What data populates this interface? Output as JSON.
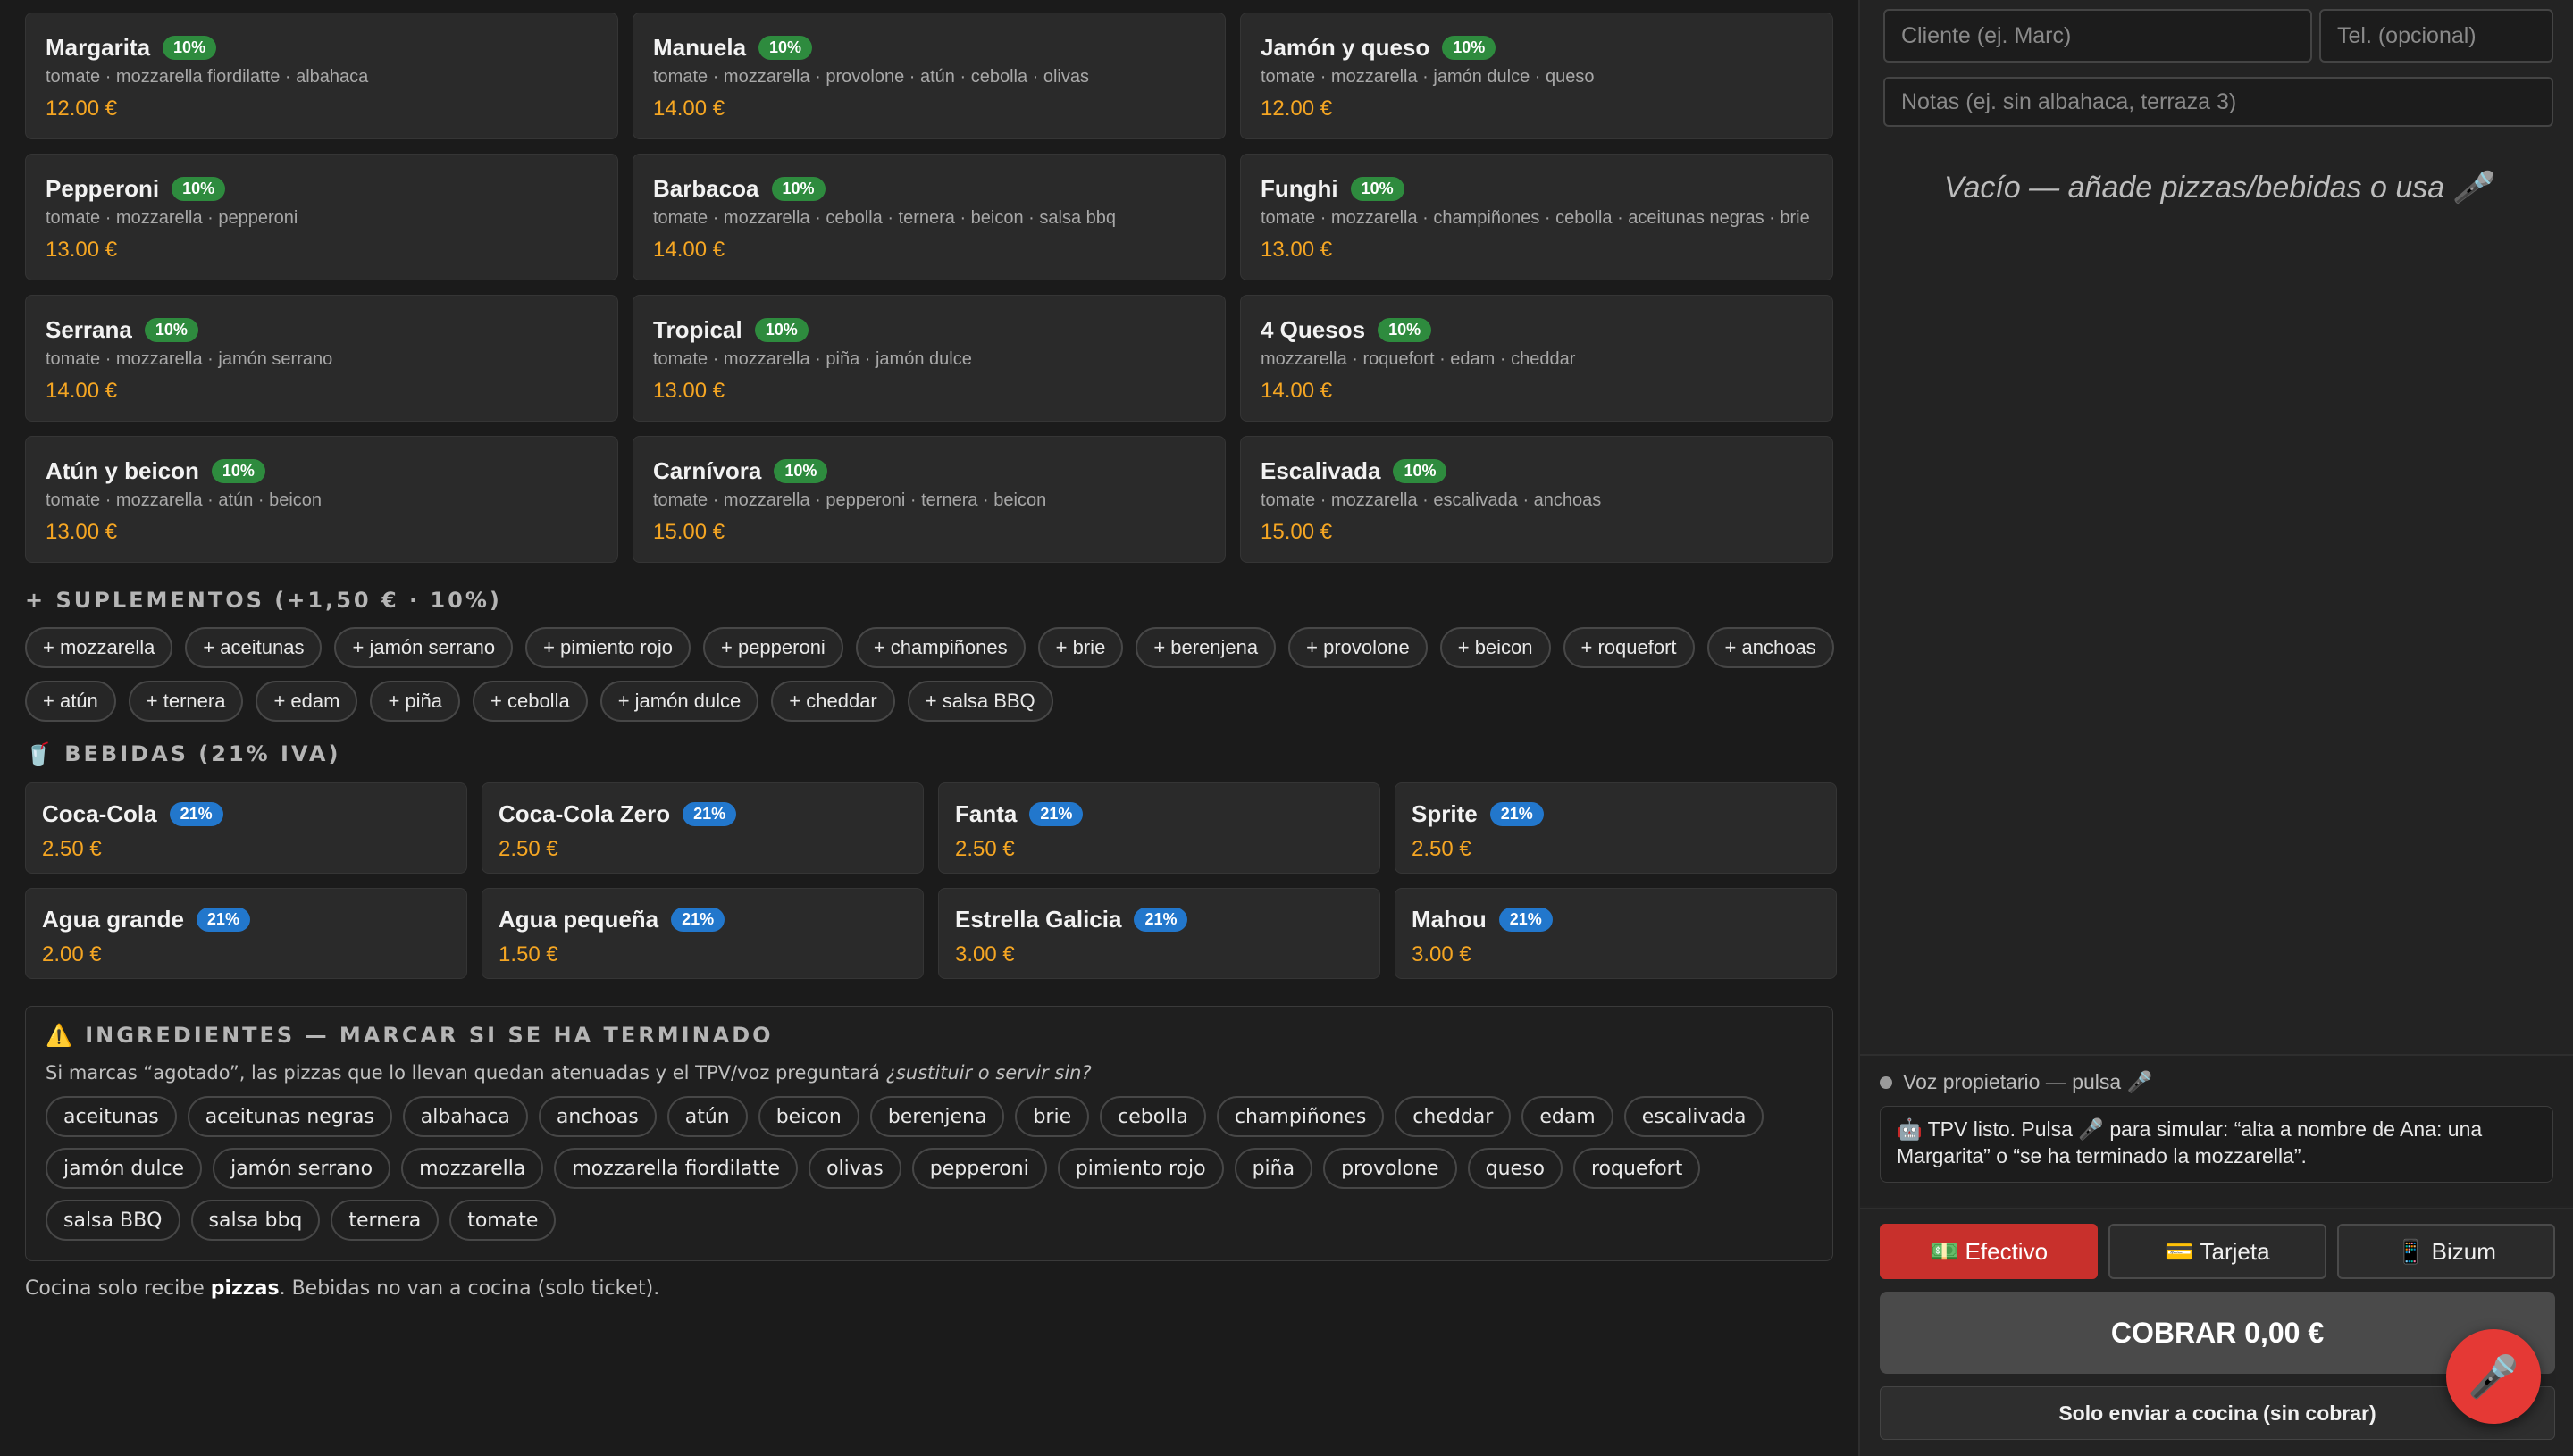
{
  "pizzas": [
    {
      "name": "Margarita",
      "badge": "10%",
      "ingredients": "tomate · mozzarella fiordilatte · albahaca",
      "price": "12.00 €"
    },
    {
      "name": "Manuela",
      "badge": "10%",
      "ingredients": "tomate · mozzarella · provolone · atún · cebolla · olivas",
      "price": "14.00 €"
    },
    {
      "name": "Jamón y queso",
      "badge": "10%",
      "ingredients": "tomate · mozzarella · jamón dulce · queso",
      "price": "12.00 €"
    },
    {
      "name": "Pepperoni",
      "badge": "10%",
      "ingredients": "tomate · mozzarella · pepperoni",
      "price": "13.00 €"
    },
    {
      "name": "Barbacoa",
      "badge": "10%",
      "ingredients": "tomate · mozzarella · cebolla · ternera · beicon · salsa bbq",
      "price": "14.00 €"
    },
    {
      "name": "Funghi",
      "badge": "10%",
      "ingredients": "tomate · mozzarella · champiñones · cebolla · aceitunas negras · brie",
      "price": "13.00 €"
    },
    {
      "name": "Serrana",
      "badge": "10%",
      "ingredients": "tomate · mozzarella · jamón serrano",
      "price": "14.00 €"
    },
    {
      "name": "Tropical",
      "badge": "10%",
      "ingredients": "tomate · mozzarella · piña · jamón dulce",
      "price": "13.00 €"
    },
    {
      "name": "4 Quesos",
      "badge": "10%",
      "ingredients": "mozzarella · roquefort · edam · cheddar",
      "price": "14.00 €"
    },
    {
      "name": "Atún y beicon",
      "badge": "10%",
      "ingredients": "tomate · mozzarella · atún · beicon",
      "price": "13.00 €"
    },
    {
      "name": "Carnívora",
      "badge": "10%",
      "ingredients": "tomate · mozzarella · pepperoni · ternera · beicon",
      "price": "15.00 €"
    },
    {
      "name": "Escalivada",
      "badge": "10%",
      "ingredients": "tomate · mozzarella · escalivada · anchoas",
      "price": "15.00 €"
    }
  ],
  "supplements_title": "+ SUPLEMENTOS (+1,50 € · 10%)",
  "supplements": [
    "+ mozzarella",
    "+ aceitunas",
    "+ jamón serrano",
    "+ pimiento rojo",
    "+ pepperoni",
    "+ champiñones",
    "+ brie",
    "+ berenjena",
    "+ provolone",
    "+ beicon",
    "+ roquefort",
    "+ anchoas",
    "+ atún",
    "+ ternera",
    "+ edam",
    "+ piña",
    "+ cebolla",
    "+ jamón dulce",
    "+ cheddar",
    "+ salsa BBQ"
  ],
  "drinks_title": "🥤 BEBIDAS (21% IVA)",
  "drinks": [
    {
      "name": "Coca-Cola",
      "badge": "21%",
      "price": "2.50 €"
    },
    {
      "name": "Coca-Cola Zero",
      "badge": "21%",
      "price": "2.50 €"
    },
    {
      "name": "Fanta",
      "badge": "21%",
      "price": "2.50 €"
    },
    {
      "name": "Sprite",
      "badge": "21%",
      "price": "2.50 €"
    },
    {
      "name": "Agua grande",
      "badge": "21%",
      "price": "2.00 €"
    },
    {
      "name": "Agua pequeña",
      "badge": "21%",
      "price": "1.50 €"
    },
    {
      "name": "Estrella Galicia",
      "badge": "21%",
      "price": "3.00 €"
    },
    {
      "name": "Mahou",
      "badge": "21%",
      "price": "3.00 €"
    }
  ],
  "ingredients_panel": {
    "title": "⚠️ INGREDIENTES — MARCAR SI SE HA TERMINADO",
    "desc_main": "Si marcas “agotado”, las pizzas que lo llevan quedan atenuadas y el TPV/voz preguntará ",
    "desc_italic": "¿sustituir o servir sin?",
    "items": [
      "aceitunas",
      "aceitunas negras",
      "albahaca",
      "anchoas",
      "atún",
      "beicon",
      "berenjena",
      "brie",
      "cebolla",
      "champiñones",
      "cheddar",
      "edam",
      "escalivada",
      "jamón dulce",
      "jamón serrano",
      "mozzarella",
      "mozzarella fiordilatte",
      "olivas",
      "pepperoni",
      "pimiento rojo",
      "piña",
      "provolone",
      "queso",
      "roquefort",
      "salsa BBQ",
      "salsa bbq",
      "ternera",
      "tomate"
    ]
  },
  "footer": {
    "pre": "Cocina solo recibe ",
    "bold": "pizzas",
    "post": ". Bebidas no van a cocina (solo ticket)."
  },
  "order": {
    "client_placeholder": "Cliente (ej. Marc)",
    "phone_placeholder": "Tel. (opcional)",
    "notes_placeholder": "Notas (ej. sin albahaca, terraza 3)",
    "empty_text": "Vacío — añade pizzas/bebidas o usa 🎤"
  },
  "voice": {
    "status": "Voz propietario — pulsa 🎤",
    "message": "🤖 TPV listo. Pulsa 🎤 para simular: “alta a nombre de Ana: una Margarita” o “se ha terminado la mozzarella”."
  },
  "payment": {
    "cash": "💵 Efectivo",
    "card": "💳 Tarjeta",
    "bizum": "📱 Bizum",
    "charge": "COBRAR 0,00 €",
    "kitchen_only": "Solo enviar a cocina (sin cobrar)"
  },
  "mic_icon": "🎤",
  "colors": {
    "accent_price": "#f5a623",
    "badge_food": "#2e8b3e",
    "badge_drink": "#2277cc",
    "cash_active": "#c8302c",
    "mic": "#e53935"
  }
}
